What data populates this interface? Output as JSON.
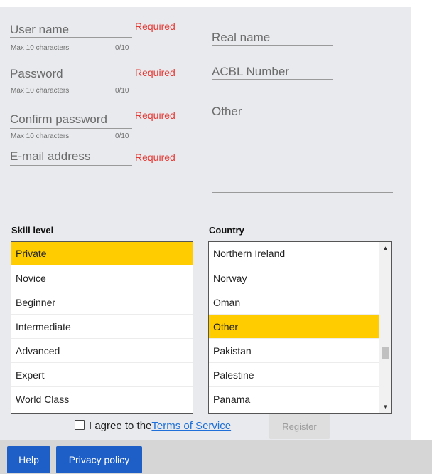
{
  "form": {
    "username": {
      "label": "User name",
      "hint": "Max 10 characters",
      "counter": "0/10",
      "required": "Required"
    },
    "password": {
      "label": "Password",
      "hint": "Max 10 characters",
      "counter": "0/10",
      "required": "Required"
    },
    "confirm_password": {
      "label": "Confirm password",
      "hint": "Max 10 characters",
      "counter": "0/10",
      "required": "Required"
    },
    "email": {
      "label": "E-mail address",
      "required": "Required"
    },
    "real_name": {
      "label": "Real name"
    },
    "acbl_number": {
      "label": "ACBL Number"
    },
    "other": {
      "label": "Other"
    }
  },
  "skill_level": {
    "label": "Skill level",
    "options": [
      "Private",
      "Novice",
      "Beginner",
      "Intermediate",
      "Advanced",
      "Expert",
      "World Class"
    ],
    "selected": "Private"
  },
  "country": {
    "label": "Country",
    "options": [
      "Northern Ireland",
      "Norway",
      "Oman",
      "Other",
      "Pakistan",
      "Palestine",
      "Panama"
    ],
    "selected": "Other"
  },
  "agree": {
    "text": "I agree to the",
    "link": "Terms of Service",
    "checked": false
  },
  "register_label": "Register",
  "footer": {
    "help_label": "Help",
    "privacy_label": "Privacy policy"
  },
  "colors": {
    "selection": "#ffcc00",
    "required": "#e53935",
    "primary_button": "#1d5fc7",
    "link": "#1e6fd9"
  },
  "icons": {
    "scroll_up": "triangle-up",
    "scroll_down": "triangle-down"
  }
}
